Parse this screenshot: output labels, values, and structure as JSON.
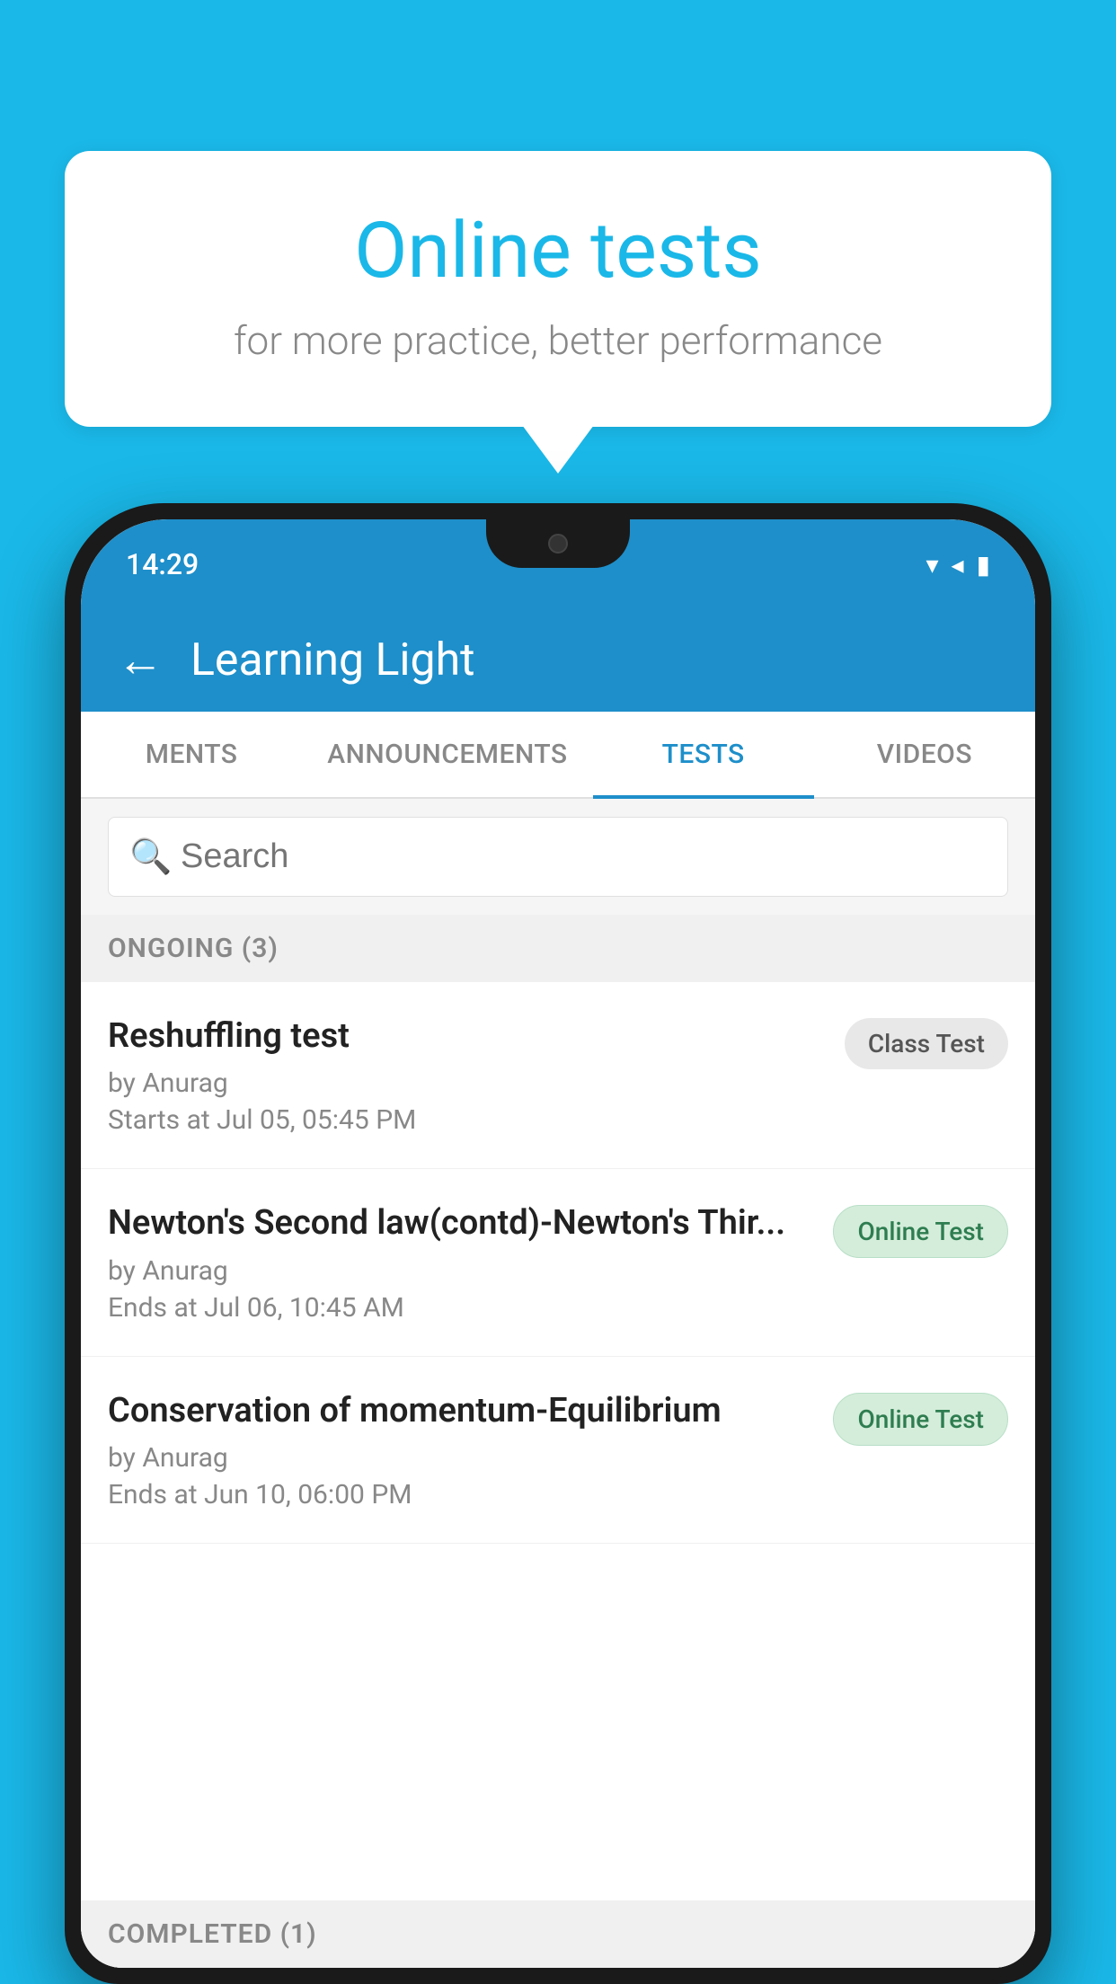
{
  "background": {
    "color": "#1ab8e8"
  },
  "bubble": {
    "title": "Online tests",
    "subtitle": "for more practice, better performance"
  },
  "phone": {
    "status_bar": {
      "time": "14:29",
      "wifi_icon": "▼",
      "signal_icon": "◀",
      "battery_icon": "▮"
    },
    "header": {
      "back_label": "←",
      "title": "Learning Light"
    },
    "tabs": [
      {
        "label": "MENTS",
        "active": false
      },
      {
        "label": "ANNOUNCEMENTS",
        "active": false
      },
      {
        "label": "TESTS",
        "active": true
      },
      {
        "label": "VIDEOS",
        "active": false
      }
    ],
    "search": {
      "placeholder": "Search"
    },
    "ongoing_section": {
      "label": "ONGOING (3)"
    },
    "tests": [
      {
        "name": "Reshuffling test",
        "by": "by Anurag",
        "time": "Starts at  Jul 05, 05:45 PM",
        "badge": "Class Test",
        "badge_type": "class"
      },
      {
        "name": "Newton's Second law(contd)-Newton's Thir...",
        "by": "by Anurag",
        "time": "Ends at  Jul 06, 10:45 AM",
        "badge": "Online Test",
        "badge_type": "online"
      },
      {
        "name": "Conservation of momentum-Equilibrium",
        "by": "by Anurag",
        "time": "Ends at  Jun 10, 06:00 PM",
        "badge": "Online Test",
        "badge_type": "online"
      }
    ],
    "completed_section": {
      "label": "COMPLETED (1)"
    }
  }
}
